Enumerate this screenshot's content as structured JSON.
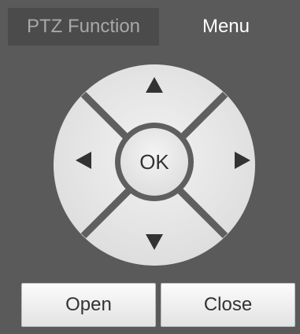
{
  "tabs": {
    "ptz_function": "PTZ Function",
    "menu": "Menu"
  },
  "dpad": {
    "center_label": "OK",
    "up_icon": "triangle-up",
    "down_icon": "triangle-down",
    "left_icon": "triangle-left",
    "right_icon": "triangle-right"
  },
  "buttons": {
    "open": "Open",
    "close": "Close"
  },
  "colors": {
    "background": "#5a5a5a",
    "active_tab_bg": "#4b4b4b",
    "pad_fill": "#e8e8e8",
    "pad_dividers": "#5f5f5f",
    "arrows": "#333333"
  }
}
